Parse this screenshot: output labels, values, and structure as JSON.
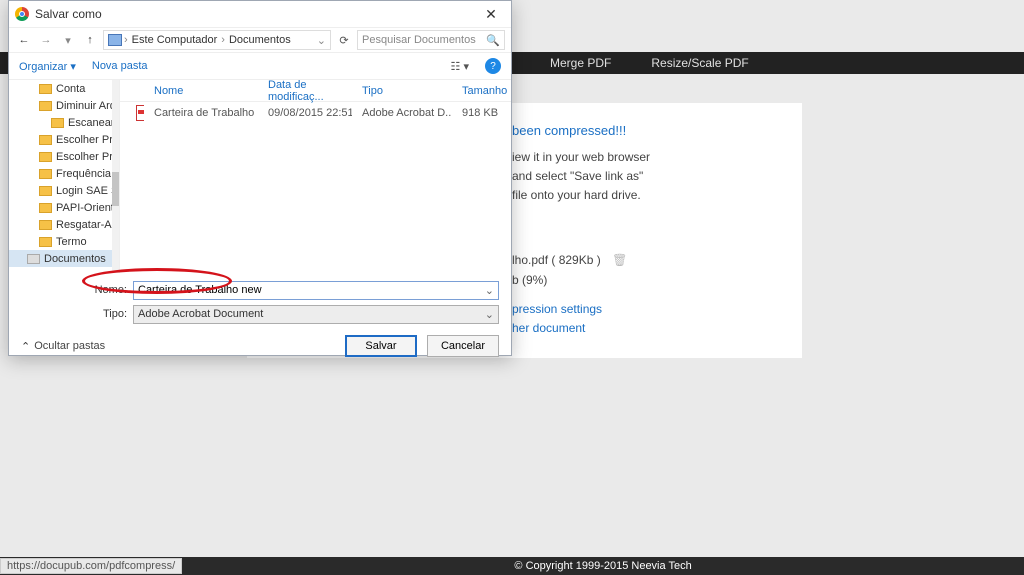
{
  "topbar": {
    "merge": "Merge PDF",
    "resize": "Resize/Scale PDF"
  },
  "content": {
    "title": "been compressed!!!",
    "line1": "iew it in your web browser",
    "line2": "and select \"Save link as\"",
    "line3": "file onto your hard drive.",
    "file_line": "lho.pdf  ( 829Kb )",
    "saving_line": "b (9%)",
    "link1": "pression settings",
    "link2": "her document"
  },
  "footer": {
    "url": "https://docupub.com/pdfcompress/",
    "copy": "© Copyright 1999-2015 Neevia Tech"
  },
  "dialog": {
    "title": "Salvar como",
    "breadcrumb": {
      "pc": "Este Computador",
      "folder": "Documentos"
    },
    "search_placeholder": "Pesquisar Documentos",
    "organize": "Organizar ▾",
    "new_folder": "Nova pasta",
    "tree": [
      {
        "label": "Conta",
        "selected": false,
        "indent": 1
      },
      {
        "label": "Diminuir Arq",
        "indent": 1
      },
      {
        "label": "Escanear",
        "indent": 2
      },
      {
        "label": "Escolher Proj",
        "indent": 1
      },
      {
        "label": "Escolher Proj",
        "indent": 1
      },
      {
        "label": "Frequência",
        "indent": 1
      },
      {
        "label": "Login SAE SIC",
        "indent": 1
      },
      {
        "label": "PAPI-Orienta",
        "indent": 1
      },
      {
        "label": "Resgatar-Alte",
        "indent": 1
      },
      {
        "label": "Termo",
        "indent": 1
      },
      {
        "label": "Documentos",
        "indent": 0,
        "system": true,
        "selected": true
      }
    ],
    "columns": {
      "name": "Nome",
      "date": "Data de modificaç...",
      "type": "Tipo",
      "size": "Tamanho"
    },
    "file": {
      "name": "Carteira de Trabalho",
      "date": "09/08/2015 22:51",
      "type": "Adobe Acrobat D...",
      "size": "918 KB"
    },
    "name_label": "Nome:",
    "name_value": "Carteira de Trabalho new",
    "type_label": "Tipo:",
    "type_value": "Adobe Acrobat Document",
    "hide_folders": "Ocultar pastas",
    "save": "Salvar",
    "cancel": "Cancelar"
  }
}
